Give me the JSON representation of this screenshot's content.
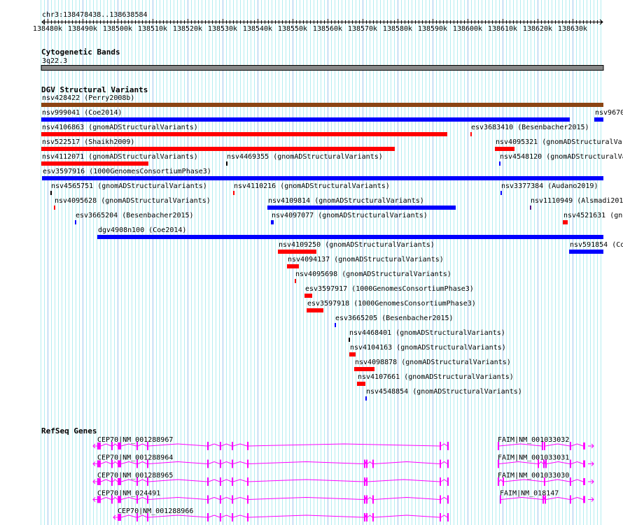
{
  "colors": {
    "grid_minor": "#b4eef0",
    "grid_major": "#9cc6ee",
    "red": "#ff0000",
    "blue": "#0000ff",
    "black": "#000000",
    "brown": "#8b4513",
    "purple": "#551a8b",
    "gene": "#ff00ff",
    "cyto": "#888888"
  },
  "ruler": {
    "region": "chr3:138478438..138638584",
    "start_kb": 138478.4,
    "end_kb": 138638.6,
    "ticks": [
      "138480k",
      "138490k",
      "138500k",
      "138510k",
      "138520k",
      "138530k",
      "138540k",
      "138550k",
      "138560k",
      "138570k",
      "138580k",
      "138590k",
      "138600k",
      "138610k",
      "138620k",
      "138630k"
    ]
  },
  "cytoband": {
    "title": "Cytogenetic Bands",
    "band": "3q22.3",
    "start_kb": 138478.2,
    "end_kb": 138638.8
  },
  "dgv": {
    "title": "DGV Structural Variants",
    "rows": [
      [
        {
          "label": "nsv428422 (Perry2008b)",
          "start": 138478.2,
          "end": 138638.8,
          "color": "brown"
        }
      ],
      [
        {
          "label": "nsv999041 (Coe2014)",
          "start": 138478.2,
          "end": 138629.2,
          "color": "blue"
        },
        {
          "label": "nsv9670",
          "start": 138636.2,
          "end": 138638.8,
          "color": "blue"
        }
      ],
      [
        {
          "label": "nsv4106863 (gnomADStructuralVariants)",
          "start": 138478.2,
          "end": 138594.2,
          "color": "red"
        },
        {
          "label": "esv3683410 (Besenbacher2015)",
          "start": 138600.8,
          "end": 138601.2,
          "color": "red"
        }
      ],
      [
        {
          "label": "nsv522517 (Shaikh2009)",
          "start": 138478.2,
          "end": 138579.2,
          "color": "red"
        },
        {
          "label": "nsv4095321 (gnomADStructuralVa",
          "start": 138607.8,
          "end": 138613.4,
          "color": "red"
        }
      ],
      [
        {
          "label": "nsv4112071 (gnomADStructuralVariants)",
          "start": 138478.2,
          "end": 138508.8,
          "color": "red"
        },
        {
          "label": "nsv4469355 (gnomADStructuralVariants)",
          "start": 138531.0,
          "end": 138531.4,
          "color": "black"
        },
        {
          "label": "nsv4548120 (gnomADStructuralVa",
          "start": 138609.0,
          "end": 138609.4,
          "color": "blue"
        }
      ],
      [
        {
          "label": "esv3597916 (1000GenomesConsortiumPhase3)",
          "start": 138478.4,
          "end": 138638.8,
          "color": "blue"
        }
      ],
      [
        {
          "label": "nsv4565751 (gnomADStructuralVariants)",
          "start": 138480.8,
          "end": 138481.2,
          "color": "black"
        },
        {
          "label": "nsv4110216 (gnomADStructuralVariants)",
          "start": 138533.0,
          "end": 138533.4,
          "color": "red"
        },
        {
          "label": "nsv3377384 (Audano2019)",
          "start": 138609.4,
          "end": 138609.8,
          "color": "blue"
        }
      ],
      [
        {
          "label": "nsv4095628 (gnomADStructuralVariants)",
          "start": 138481.8,
          "end": 138482.2,
          "color": "red"
        },
        {
          "label": "nsv4109814 (gnomADStructuralVariants)",
          "start": 138542.8,
          "end": 138596.6,
          "color": "blue"
        },
        {
          "label": "nsv1110949 (Alsmadi201",
          "start": 138617.8,
          "end": 138618.2,
          "color": "purple"
        }
      ],
      [
        {
          "label": "esv3665204 (Besenbacher2015)",
          "start": 138487.8,
          "end": 138488.2,
          "color": "blue"
        },
        {
          "label": "nsv4097077 (gnomADStructuralVariants)",
          "start": 138543.8,
          "end": 138544.6,
          "color": "blue"
        },
        {
          "label": "nsv4521631 (gno",
          "start": 138627.2,
          "end": 138628.6,
          "color": "red"
        }
      ],
      [
        {
          "label": "dgv4908n100 (Coe2014)",
          "start": 138494.2,
          "end": 138638.8,
          "color": "blue"
        }
      ],
      [
        {
          "label": "nsv4109250 (gnomADStructuralVariants)",
          "start": 138545.8,
          "end": 138556.8,
          "color": "red"
        },
        {
          "label": "nsv591854 (Co",
          "start": 138629.0,
          "end": 138638.8,
          "color": "blue"
        }
      ],
      [
        {
          "label": "nsv4094137 (gnomADStructuralVariants)",
          "start": 138548.4,
          "end": 138551.8,
          "color": "red"
        }
      ],
      [
        {
          "label": "nsv4095698 (gnomADStructuralVariants)",
          "start": 138550.6,
          "end": 138551.0,
          "color": "red"
        }
      ],
      [
        {
          "label": "esv3597917 (1000GenomesConsortiumPhase3)",
          "start": 138553.4,
          "end": 138555.6,
          "color": "red"
        }
      ],
      [
        {
          "label": "esv3597918 (1000GenomesConsortiumPhase3)",
          "start": 138554.0,
          "end": 138558.8,
          "color": "red"
        }
      ],
      [
        {
          "label": "esv3665205 (Besenbacher2015)",
          "start": 138562.0,
          "end": 138562.4,
          "color": "blue"
        }
      ],
      [
        {
          "label": "nsv4468401 (gnomADStructuralVariants)",
          "start": 138566.0,
          "end": 138566.4,
          "color": "black"
        }
      ],
      [
        {
          "label": "nsv4104163 (gnomADStructuralVariants)",
          "start": 138566.2,
          "end": 138568.0,
          "color": "red"
        }
      ],
      [
        {
          "label": "nsv4098878 (gnomADStructuralVariants)",
          "start": 138567.6,
          "end": 138573.4,
          "color": "red"
        }
      ],
      [
        {
          "label": "nsv4107661 (gnomADStructuralVariants)",
          "start": 138568.4,
          "end": 138570.8,
          "color": "red"
        }
      ],
      [
        {
          "label": "nsv4548854 (gnomADStructuralVariants)",
          "start": 138570.8,
          "end": 138571.2,
          "color": "blue"
        }
      ]
    ]
  },
  "refseq": {
    "title": "RefSeq Genes",
    "rows": [
      [
        {
          "label": "CEP70|NM_001288967",
          "strand": "-",
          "start": 138494.2,
          "end": 138594.6,
          "exons": [
            [
              138494.2,
              138495.2
            ],
            [
              138498.2,
              138498.6
            ],
            [
              138500.0,
              138501.0
            ],
            [
              138505.4,
              138505.8
            ],
            [
              138508.4,
              138508.8
            ],
            [
              138525.6,
              138526.0
            ],
            [
              138529.2,
              138529.6
            ],
            [
              138532.6,
              138533.0
            ],
            [
              138537.0,
              138537.4
            ],
            [
              138592.0,
              138592.4
            ],
            [
              138594.2,
              138594.6
            ]
          ]
        },
        {
          "label": "FAIM|NM_001033032",
          "strand": "+",
          "start": 138608.6,
          "end": 138634.4,
          "exons": [
            [
              138608.6,
              138609.0
            ],
            [
              138621.2,
              138621.6
            ],
            [
              138621.8,
              138622.2
            ],
            [
              138629.2,
              138629.6
            ],
            [
              138633.0,
              138633.6
            ]
          ]
        }
      ],
      [
        {
          "label": "CEP70|NM_001288964",
          "strand": "-",
          "start": 138494.2,
          "end": 138594.6,
          "exons": [
            [
              138494.2,
              138495.2
            ],
            [
              138498.2,
              138498.6
            ],
            [
              138500.0,
              138501.0
            ],
            [
              138505.4,
              138505.8
            ],
            [
              138508.4,
              138508.8
            ],
            [
              138525.6,
              138526.0
            ],
            [
              138529.2,
              138529.6
            ],
            [
              138532.6,
              138533.0
            ],
            [
              138537.0,
              138537.4
            ],
            [
              138570.4,
              138570.8
            ],
            [
              138571.0,
              138571.4
            ],
            [
              138572.8,
              138573.2
            ],
            [
              138592.0,
              138592.4
            ],
            [
              138594.2,
              138594.6
            ]
          ]
        },
        {
          "label": "FAIM|NM_001033031",
          "strand": "+",
          "start": 138608.6,
          "end": 138634.4,
          "exons": [
            [
              138608.6,
              138609.0
            ],
            [
              138620.0,
              138620.4
            ],
            [
              138621.6,
              138622.0
            ],
            [
              138622.2,
              138622.6
            ],
            [
              138629.2,
              138629.6
            ],
            [
              138633.0,
              138633.6
            ]
          ]
        }
      ],
      [
        {
          "label": "CEP70|NM_001288965",
          "strand": "-",
          "start": 138494.2,
          "end": 138594.6,
          "exons": [
            [
              138494.2,
              138495.2
            ],
            [
              138498.2,
              138498.6
            ],
            [
              138500.0,
              138501.0
            ],
            [
              138505.4,
              138505.8
            ],
            [
              138508.4,
              138508.8
            ],
            [
              138525.6,
              138526.0
            ],
            [
              138529.2,
              138529.6
            ],
            [
              138532.6,
              138533.0
            ],
            [
              138537.0,
              138537.4
            ],
            [
              138570.4,
              138570.8
            ],
            [
              138571.0,
              138571.4
            ],
            [
              138592.0,
              138592.4
            ],
            [
              138594.2,
              138594.6
            ]
          ]
        },
        {
          "label": "FAIM|NM_001033030",
          "strand": "+",
          "start": 138608.6,
          "end": 138634.4,
          "exons": [
            [
              138608.6,
              138609.0
            ],
            [
              138610.0,
              138610.4
            ],
            [
              138621.8,
              138622.2
            ],
            [
              138629.2,
              138629.6
            ],
            [
              138633.0,
              138633.6
            ]
          ]
        }
      ],
      [
        {
          "label": "CEP70|NM_024491",
          "strand": "-",
          "start": 138494.2,
          "end": 138594.6,
          "exons": [
            [
              138494.2,
              138495.2
            ],
            [
              138498.2,
              138498.6
            ],
            [
              138500.0,
              138501.0
            ],
            [
              138505.4,
              138505.8
            ],
            [
              138508.4,
              138508.8
            ],
            [
              138525.6,
              138526.0
            ],
            [
              138529.2,
              138529.6
            ],
            [
              138532.6,
              138533.0
            ],
            [
              138537.0,
              138537.4
            ],
            [
              138570.4,
              138570.8
            ],
            [
              138571.0,
              138571.4
            ],
            [
              138572.8,
              138573.2
            ],
            [
              138592.0,
              138592.4
            ],
            [
              138594.2,
              138594.6
            ]
          ]
        },
        {
          "label": "FAIM|NM_018147",
          "strand": "+",
          "start": 138609.2,
          "end": 138634.4,
          "exons": [
            [
              138609.2,
              138609.6
            ],
            [
              138621.4,
              138621.8
            ],
            [
              138622.0,
              138622.4
            ],
            [
              138629.2,
              138629.6
            ],
            [
              138633.0,
              138633.6
            ]
          ]
        }
      ],
      [
        {
          "label": "CEP70|NM_001288966",
          "strand": "-",
          "start": 138500.0,
          "end": 138594.6,
          "exons": [
            [
              138500.0,
              138501.0
            ],
            [
              138505.4,
              138505.8
            ],
            [
              138508.4,
              138508.8
            ],
            [
              138525.6,
              138526.0
            ],
            [
              138529.2,
              138529.6
            ],
            [
              138532.6,
              138533.0
            ],
            [
              138537.0,
              138537.4
            ],
            [
              138570.4,
              138570.8
            ],
            [
              138571.0,
              138571.4
            ],
            [
              138572.8,
              138573.2
            ],
            [
              138592.0,
              138592.4
            ],
            [
              138594.2,
              138594.6
            ]
          ]
        }
      ]
    ]
  }
}
